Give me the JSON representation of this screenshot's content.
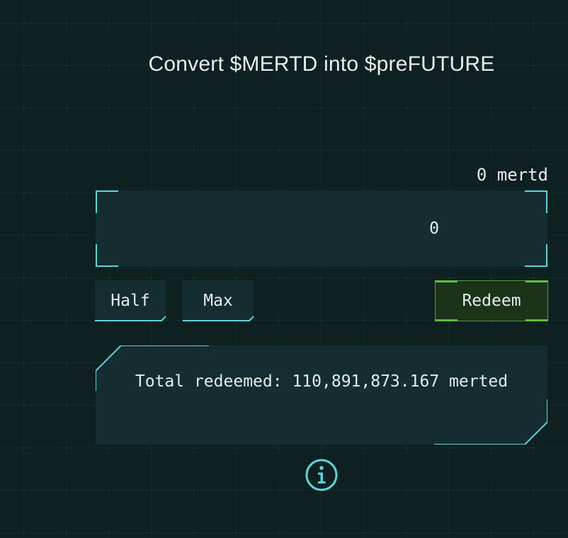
{
  "title": "Convert $MERTD into $preFUTURE",
  "balance": "0 mertd",
  "amount_input": {
    "value": "0",
    "placeholder": "0"
  },
  "buttons": {
    "half": "Half",
    "max": "Max",
    "redeem": "Redeem"
  },
  "total": {
    "label": "Total redeemed:",
    "value": "110,891,873.167",
    "unit": "merted"
  },
  "icons": {
    "info": "info-icon"
  },
  "colors": {
    "background": "#0e2020",
    "panel": "#152d30",
    "accent_cyan": "#5fd3d9",
    "redeem_bg": "#1b3318",
    "redeem_accent": "#5fbf3c"
  }
}
